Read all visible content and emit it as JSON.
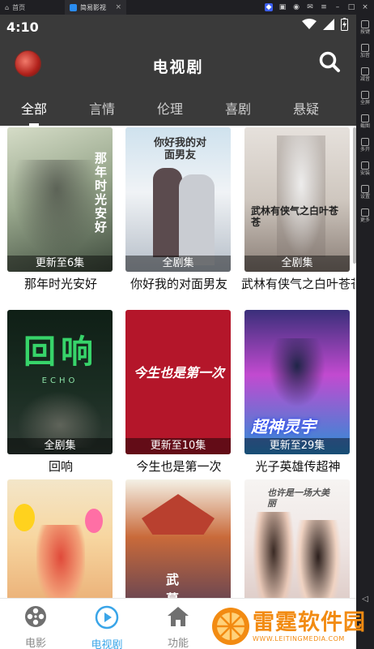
{
  "emulator": {
    "home_tab": "首页",
    "app_tab": "简易影视",
    "sidebar": [
      "按键",
      "加音",
      "减音",
      "全屏",
      "截图",
      "多开",
      "安装",
      "设置",
      "更多"
    ]
  },
  "status": {
    "time": "4:10"
  },
  "header": {
    "title": "电视剧"
  },
  "tabs": [
    "全部",
    "言情",
    "伦理",
    "喜剧",
    "悬疑"
  ],
  "items": [
    {
      "title": "那年时光安好",
      "badge": "更新至6集",
      "poster_text": "那年时光安好"
    },
    {
      "title": "你好我的对面男友",
      "badge": "全剧集",
      "poster_text": "你好我的对面男友"
    },
    {
      "title": "武林有侠气之白叶苍苍",
      "badge": "全剧集",
      "poster_text": "武林有侠气之白叶苍苍"
    },
    {
      "title": "回响",
      "badge": "全剧集",
      "poster_text": "回响",
      "poster_sub": "ECHO"
    },
    {
      "title": "今生也是第一次",
      "badge": "更新至10集",
      "poster_text": "今生也是第一次"
    },
    {
      "title": "光子英雄传超神",
      "badge": "更新至29集",
      "poster_text": "超神灵宇"
    },
    {
      "title": "",
      "badge": ""
    },
    {
      "title": "",
      "badge": "",
      "poster_text": "武幕"
    },
    {
      "title": "",
      "badge": "",
      "poster_text": "也许是一场大美丽"
    }
  ],
  "nav": [
    {
      "label": "电影",
      "icon": "film-reel-icon"
    },
    {
      "label": "电视剧",
      "icon": "play-icon"
    },
    {
      "label": "功能",
      "icon": "home-icon"
    }
  ],
  "watermark": {
    "name": "雷霆软件园",
    "url": "WWW.LEITINGMEDIA.COM"
  },
  "colors": {
    "header_bg": "#3a3a3a",
    "active_nav": "#3aa5e8",
    "watermark": "#f28b12"
  }
}
